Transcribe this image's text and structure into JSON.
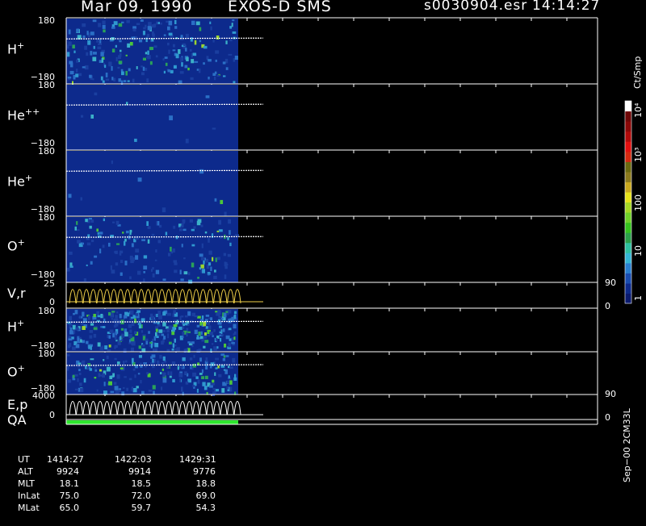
{
  "header": {
    "date": "Mar 09, 1990",
    "mission": "EXOS-D SMS",
    "file": "s0030904.esr",
    "time": "14:14:27"
  },
  "colors": {
    "background": "#000000",
    "bar_bg": "#0d2a8c",
    "axis": "#ffffff",
    "vr_trace": "#f2d24a",
    "qa_bar": "#2ee62e"
  },
  "panels": [
    {
      "id": "h-plus-1",
      "label": "H",
      "sup": "+",
      "ymax": "180",
      "ymin": "−180"
    },
    {
      "id": "he-plus-plus",
      "label": "He",
      "sup": "++",
      "ymax": "180",
      "ymin": "−180"
    },
    {
      "id": "he-plus",
      "label": "He",
      "sup": "+",
      "ymax": "180",
      "ymin": "−180"
    },
    {
      "id": "o-plus-1",
      "label": "O",
      "sup": "+",
      "ymax": "180",
      "ymin": "−180"
    },
    {
      "id": "vr",
      "label": "V,r",
      "sup": "",
      "ymax": "25",
      "ymin": "0",
      "rmax": "90",
      "rmin": "0"
    },
    {
      "id": "h-plus-2",
      "label": "H",
      "sup": "+",
      "ymax": "180",
      "ymin": "−180"
    },
    {
      "id": "o-plus-2",
      "label": "O",
      "sup": "+",
      "ymax": "180",
      "ymin": "−180"
    },
    {
      "id": "ep",
      "label": "E,p",
      "sup": "",
      "ymax": "4000",
      "ymin": "0",
      "rmax": "90",
      "rmin": "0"
    }
  ],
  "qa_label": "QA",
  "colorbar": {
    "unit": "Ct/Smp",
    "ticks": [
      "1",
      "10",
      "100",
      "10³",
      "10⁴"
    ],
    "colors": [
      "#0a1a6e",
      "#0d2a8c",
      "#1a4db0",
      "#2a7fd0",
      "#35b5d5",
      "#2fc0a0",
      "#2ba04a",
      "#35c21f",
      "#6fd12a",
      "#a6d825",
      "#e6e21a",
      "#c9a81f",
      "#8c7a1e",
      "#6b6a10",
      "#d42a10",
      "#e20f0f",
      "#b00a0a",
      "#8a0808",
      "#6e0707",
      "#ffffff"
    ]
  },
  "footer": {
    "row_labels": [
      "UT",
      "ALT",
      "MLT",
      "InLat",
      "MLat"
    ],
    "columns": [
      [
        "1414:27",
        "9924",
        "18.1",
        "75.0",
        "65.0"
      ],
      [
        "1422:03",
        "9914",
        "18.5",
        "72.0",
        "59.7"
      ],
      [
        "1429:31",
        "9776",
        "18.8",
        "69.0",
        "54.3"
      ]
    ],
    "side_note": "Sep−00 2CM33L"
  },
  "chart_data": {
    "type": "heatmap",
    "title": "Mar 09, 1990   EXOS-D SMS",
    "x": [
      "1414:27",
      "1422:03",
      "1429:31"
    ],
    "colorbar_unit": "Ct/Smp",
    "colorbar_ticks": [
      "1",
      "10",
      "100",
      "10³",
      "10⁴"
    ],
    "panels": [
      {
        "name": "H+",
        "ylim": [
          -180,
          180
        ]
      },
      {
        "name": "He++",
        "ylim": [
          -180,
          180
        ]
      },
      {
        "name": "He+",
        "ylim": [
          -180,
          180
        ]
      },
      {
        "name": "O+",
        "ylim": [
          -180,
          180
        ]
      },
      {
        "name": "V,r",
        "ylim": [
          0,
          25
        ],
        "right_ylim": [
          0,
          90
        ]
      },
      {
        "name": "H+",
        "ylim": [
          -180,
          180
        ]
      },
      {
        "name": "O+",
        "ylim": [
          -180,
          180
        ]
      },
      {
        "name": "E,p",
        "ylim": [
          0,
          4000
        ],
        "right_ylim": [
          0,
          90
        ]
      }
    ]
  }
}
